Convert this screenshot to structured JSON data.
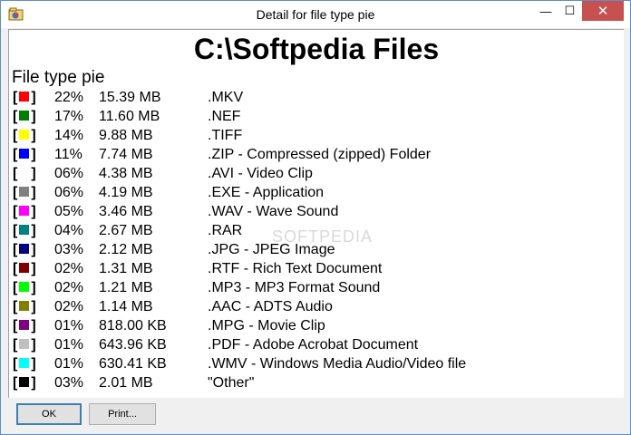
{
  "window": {
    "title": "Detail for file type pie",
    "minimize": "—",
    "maximize": "☐",
    "close": "✕"
  },
  "heading": "C:\\Softpedia Files",
  "subheading": "File type pie",
  "rows": [
    {
      "color": "#ff0000",
      "pct": "22%",
      "size": "15.39 MB",
      "desc": ".MKV"
    },
    {
      "color": "#008000",
      "pct": "17%",
      "size": "11.60 MB",
      "desc": ".NEF"
    },
    {
      "color": "#ffff00",
      "pct": "14%",
      "size": "9.88 MB",
      "desc": ".TIFF"
    },
    {
      "color": "#0000ff",
      "pct": "11%",
      "size": "7.74 MB",
      "desc": ".ZIP - Compressed (zipped) Folder"
    },
    {
      "color": "#ffffff",
      "pct": "06%",
      "size": "4.38 MB",
      "desc": ".AVI - Video Clip"
    },
    {
      "color": "#808080",
      "pct": "06%",
      "size": "4.19 MB",
      "desc": ".EXE - Application"
    },
    {
      "color": "#ff00ff",
      "pct": "05%",
      "size": "3.46 MB",
      "desc": ".WAV - Wave Sound"
    },
    {
      "color": "#008080",
      "pct": "04%",
      "size": "2.67 MB",
      "desc": ".RAR"
    },
    {
      "color": "#000080",
      "pct": "03%",
      "size": "2.12 MB",
      "desc": ".JPG - JPEG Image"
    },
    {
      "color": "#800000",
      "pct": "02%",
      "size": "1.31 MB",
      "desc": ".RTF - Rich Text Document"
    },
    {
      "color": "#00ff00",
      "pct": "02%",
      "size": "1.21 MB",
      "desc": ".MP3 - MP3 Format Sound"
    },
    {
      "color": "#808000",
      "pct": "02%",
      "size": "1.14 MB",
      "desc": ".AAC - ADTS Audio"
    },
    {
      "color": "#800080",
      "pct": "01%",
      "size": "818.00 KB",
      "desc": ".MPG - Movie Clip"
    },
    {
      "color": "#c0c0c0",
      "pct": "01%",
      "size": "643.96 KB",
      "desc": ".PDF - Adobe Acrobat Document"
    },
    {
      "color": "#00ffff",
      "pct": "01%",
      "size": "630.41 KB",
      "desc": ".WMV - Windows Media Audio/Video file"
    },
    {
      "color": "#000000",
      "pct": "03%",
      "size": "2.01 MB",
      "desc": "\"Other\""
    }
  ],
  "buttons": {
    "ok": "OK",
    "print": "Print..."
  },
  "watermark": "SOFTPEDIA"
}
